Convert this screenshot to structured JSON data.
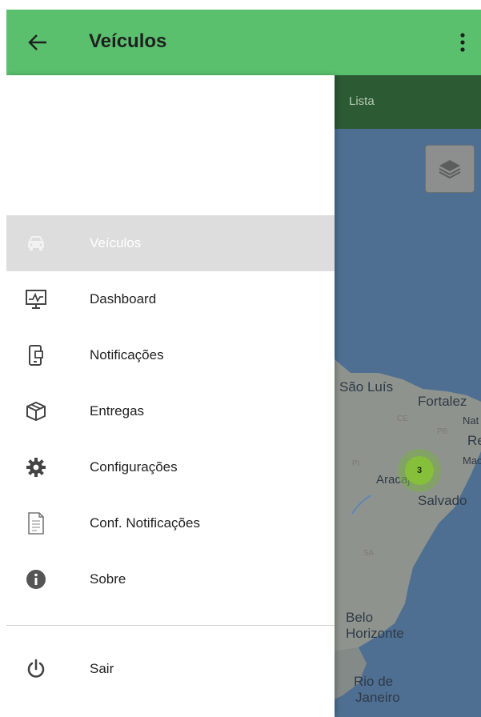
{
  "appbar": {
    "title": "Veículos",
    "back_icon": "arrow-left-icon",
    "menu_icon": "more-vertical-icon",
    "color": "#5ac06e"
  },
  "map": {
    "tab_label": "Lista",
    "cities": [
      "São Luís",
      "Fortalez",
      "Nat",
      "Re",
      "Mac",
      "Aracaju",
      "Salvado",
      "Belo",
      "Horizonte",
      "Rio de",
      "Janeiro"
    ],
    "state_labels": [
      "CE",
      "PB",
      "PI",
      "SA"
    ],
    "cluster_count": "3",
    "layers_icon": "layers-icon"
  },
  "drawer": {
    "items": [
      {
        "label": "Veículos",
        "icon": "car-icon",
        "selected": true
      },
      {
        "label": "Dashboard",
        "icon": "monitor-chart-icon"
      },
      {
        "label": "Notificações",
        "icon": "mobile-notification-icon"
      },
      {
        "label": "Entregas",
        "icon": "package-icon"
      },
      {
        "label": "Configurações",
        "icon": "gear-icon"
      },
      {
        "label": "Conf. Notificações",
        "icon": "document-icon"
      },
      {
        "label": "Sobre",
        "icon": "info-icon"
      }
    ],
    "logout": {
      "label": "Sair",
      "icon": "power-icon"
    }
  }
}
